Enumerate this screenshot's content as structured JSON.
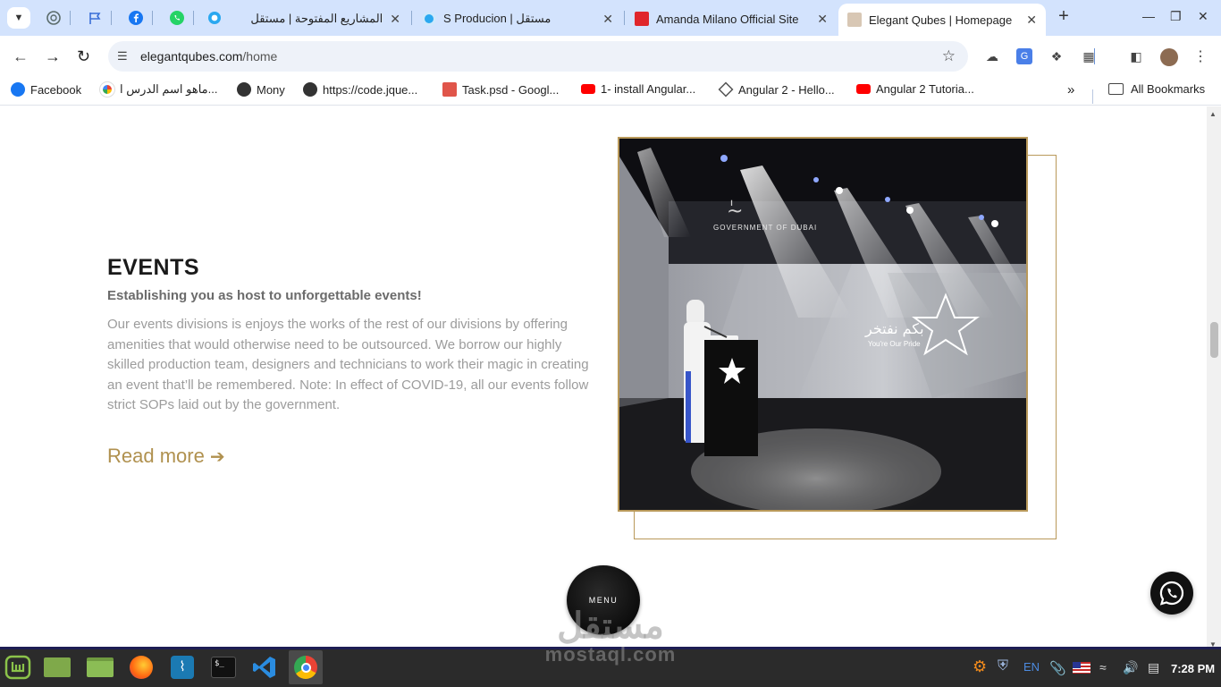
{
  "browser": {
    "pinned_tabs": [
      "chatgpt-icon",
      "flag-icon",
      "facebook-icon",
      "whatsapp-icon",
      "circle-app-icon"
    ],
    "tabs": [
      {
        "title": "المشاريع المفتوحة | مستقل",
        "icon": "mostaql-icon",
        "active": false
      },
      {
        "title": "S Producion | مستقل",
        "icon": "mostaql-icon",
        "active": false
      },
      {
        "title": "Amanda Milano Official Site",
        "icon": "adobe-icon",
        "active": false
      },
      {
        "title": "Elegant Qubes | Homepage",
        "icon": "site-icon",
        "active": true
      }
    ],
    "url_host": "elegantqubes.com",
    "url_path": "/home",
    "bookmarks": [
      {
        "label": "Facebook",
        "icon": "facebook-icon"
      },
      {
        "label": "ماهو اسم الدرس ا...",
        "icon": "google-icon"
      },
      {
        "label": "Mony",
        "icon": "globe-icon"
      },
      {
        "label": "https://code.jque...",
        "icon": "globe-icon"
      },
      {
        "label": "Task.psd - Googl...",
        "icon": "drive-image-icon"
      },
      {
        "label": "1- install Angular...",
        "icon": "youtube-icon"
      },
      {
        "label": "Angular 2 - Hello...",
        "icon": "angular-icon"
      },
      {
        "label": "Angular 2 Tutoria...",
        "icon": "youtube-icon"
      }
    ],
    "all_bookmarks_label": "All Bookmarks",
    "more_bookmarks_glyph": "»"
  },
  "section": {
    "title": "EVENTS",
    "subtitle": "Establishing you as host to unforgettable events!",
    "body": "Our events divisions is enjoys the works of the rest of our divisions by offering amenities that would otherwise need to be outsourced. We borrow our highly skilled production team, designers and technicians to work their magic in creating an event that’ll be remembered. Note: In effect of COVID-19, all our events follow strict SOPs laid out by the government.",
    "read_more": "Read more",
    "accent_color": "#b0914f"
  },
  "photo": {
    "screen_text_top": "GOVERNMENT OF DUBAI",
    "screen_text_ar": "بكم نفتخر",
    "screen_text_en": "You're Our Pride"
  },
  "menu_button": {
    "label": "MENU"
  },
  "watermark": {
    "arabic": "مستقل",
    "latin": "mostaql.com"
  },
  "taskbar": {
    "apps": [
      "mint-menu-icon",
      "desktop-folder-icon",
      "files-icon",
      "firefox-icon",
      "mysql-workbench-icon",
      "terminal-icon",
      "vscode-icon",
      "chrome-icon"
    ],
    "lang": "EN",
    "time": "7:28 PM"
  }
}
